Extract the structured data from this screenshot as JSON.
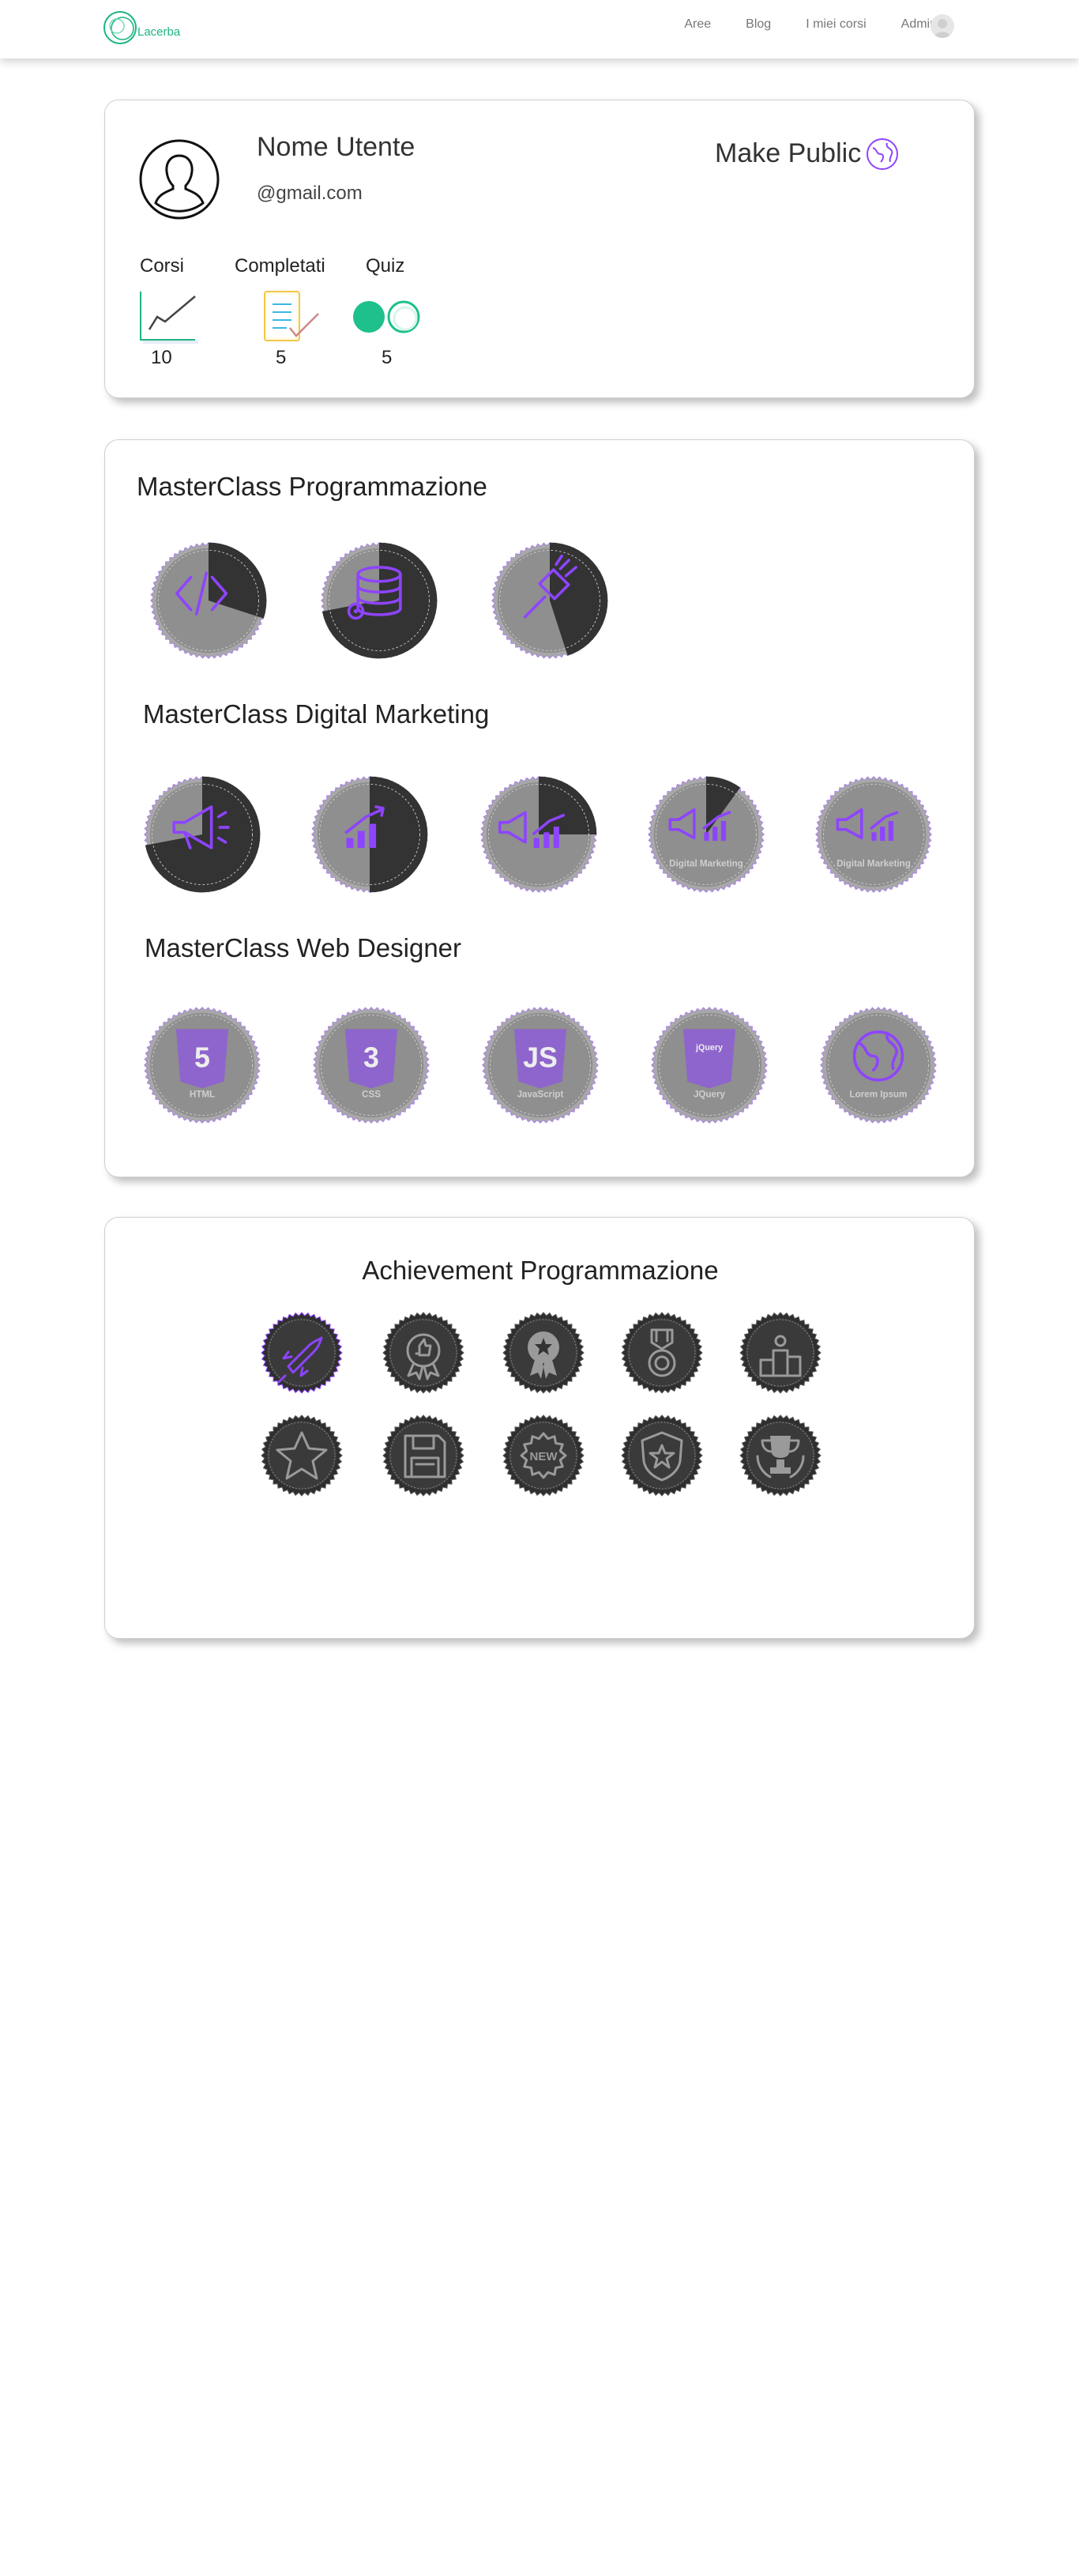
{
  "app": {
    "logo_text": "Lacerba"
  },
  "nav": {
    "items": [
      {
        "label": "Aree"
      },
      {
        "label": "Blog"
      },
      {
        "label": "I miei corsi"
      },
      {
        "label": "Admin"
      }
    ]
  },
  "profile": {
    "name": "Nome Utente",
    "email": "@gmail.com",
    "make_public_label": "Make Public",
    "stats": [
      {
        "label": "Corsi",
        "value": "10",
        "icon": "chart-icon"
      },
      {
        "label": "Completati",
        "value": "5",
        "icon": "checklist-icon"
      },
      {
        "label": "Quiz",
        "value": "5",
        "icon": "toggle-icon"
      }
    ]
  },
  "masterclasses": [
    {
      "title": "MasterClass Programmazione",
      "badges": [
        {
          "icon": "code-icon",
          "progress": 0.3
        },
        {
          "icon": "database-icon",
          "progress": 0.72
        },
        {
          "icon": "paintbrush-icon",
          "progress": 0.45
        }
      ]
    },
    {
      "title": "MasterClass Digital Marketing",
      "badges": [
        {
          "icon": "megaphone-icon",
          "progress": 0.72
        },
        {
          "icon": "growth-chart-icon",
          "progress": 0.5
        },
        {
          "icon": "marketing-icon",
          "progress": 0.25
        },
        {
          "icon": "digital-marketing-icon",
          "progress": 0.1,
          "caption": "Digital Marketing"
        },
        {
          "icon": "digital-marketing-icon",
          "progress": 0.0,
          "caption": "Digital Marketing"
        }
      ]
    },
    {
      "title": "MasterClass Web Designer",
      "badges": [
        {
          "icon": "html5-icon",
          "progress": 0.0,
          "caption": "HTML",
          "glyph": "5"
        },
        {
          "icon": "css3-icon",
          "progress": 0.0,
          "caption": "CSS",
          "glyph": "3"
        },
        {
          "icon": "javascript-icon",
          "progress": 0.0,
          "caption": "JavaScript",
          "glyph": "JS"
        },
        {
          "icon": "jquery-icon",
          "progress": 0.0,
          "caption": "JQuery",
          "glyph": "jQuery"
        },
        {
          "icon": "globe-icon",
          "progress": 0.0,
          "caption": "Lorem Ipsum"
        }
      ]
    }
  ],
  "achievements": {
    "title": "Achievement Programmazione",
    "items": [
      {
        "icon": "rocket-icon",
        "unlocked": true
      },
      {
        "icon": "thumbs-up-medal-icon",
        "unlocked": false
      },
      {
        "icon": "star-ribbon-icon",
        "unlocked": false
      },
      {
        "icon": "medal-icon",
        "unlocked": false
      },
      {
        "icon": "podium-icon",
        "unlocked": false
      },
      {
        "icon": "star-icon",
        "unlocked": false
      },
      {
        "icon": "floppy-disk-icon",
        "unlocked": false
      },
      {
        "icon": "new-badge-icon",
        "unlocked": false,
        "glyph": "NEW"
      },
      {
        "icon": "star-shield-icon",
        "unlocked": false
      },
      {
        "icon": "trophy-icon",
        "unlocked": false
      }
    ]
  },
  "colors": {
    "accent": "#1db584",
    "badge_gray": "#8f8f8f",
    "badge_dark": "#333333",
    "icon_purple": "#8e44ff"
  }
}
